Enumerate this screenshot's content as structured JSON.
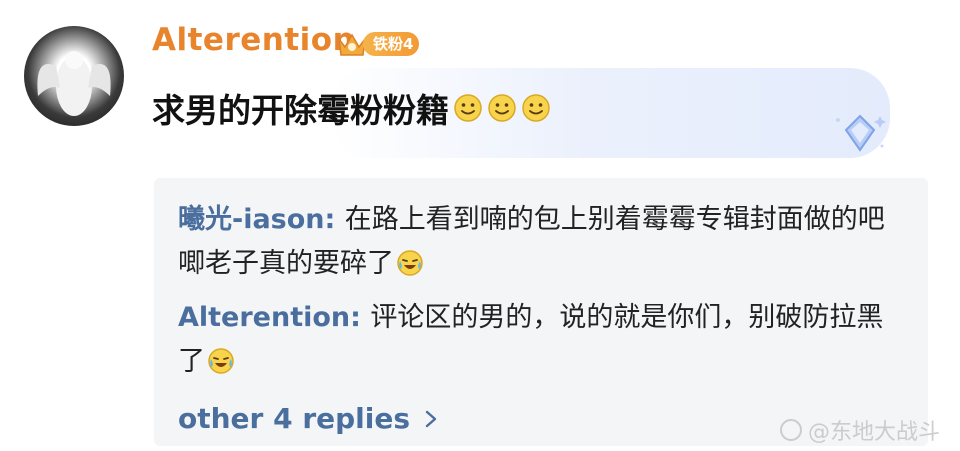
{
  "comment": {
    "username": "Alterention",
    "fan_badge": "铁粉4",
    "text": "求男的开除霉粉粉籍",
    "emoji": [
      "smile-emoji",
      "smile-emoji",
      "smile-emoji"
    ]
  },
  "replies": [
    {
      "name": "曦光-iason",
      "separator": ": ",
      "text": "在路上看到喃的包上别着霉霉专辑封面做的吧唧老子真的要碎了",
      "emoji": "laugh-cry-emoji"
    },
    {
      "name": "Alterention",
      "separator": ": ",
      "text": "评论区的男的，说的就是你们，别破防拉黑了",
      "emoji": "laugh-cry-emoji"
    }
  ],
  "more_replies_label": "other 4 replies",
  "watermark": "@东地大战斗",
  "colors": {
    "username": "#e8842c",
    "reply_name": "#4a6e9e",
    "reply_bg": "#f4f5f7"
  }
}
